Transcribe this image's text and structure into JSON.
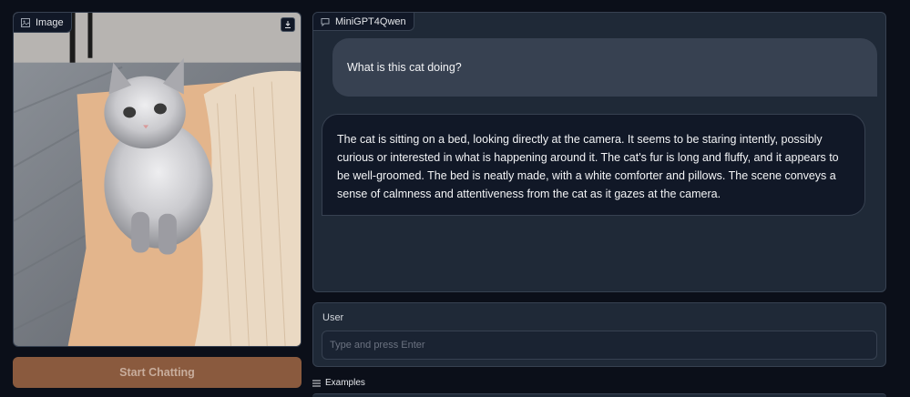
{
  "image_panel": {
    "label": "Image",
    "label_icon": "image-icon",
    "download_icon": "download-icon"
  },
  "start_button": {
    "label": "Start Chatting"
  },
  "chatbot": {
    "label": "MiniGPT4Qwen",
    "label_icon": "chat-icon",
    "messages": [
      {
        "role": "user",
        "text": "What is this cat doing?"
      },
      {
        "role": "bot",
        "text": "The cat is sitting on a bed, looking directly at the camera. It seems to be staring intently, possibly curious or interested in what is happening around it. The cat's fur is long and fluffy, and it appears to be well-groomed. The bed is neatly made, with a white comforter and pillows. The scene conveys a sense of calmness and attentiveness from the cat as it gazes at the camera."
      }
    ]
  },
  "user_input": {
    "label": "User",
    "placeholder": "Type and press Enter",
    "value": ""
  },
  "examples": {
    "label": "Examples",
    "icon": "list-icon"
  },
  "colors": {
    "background": "#0b0f19",
    "panel": "#1f2937",
    "button": "#8a5a3e"
  }
}
